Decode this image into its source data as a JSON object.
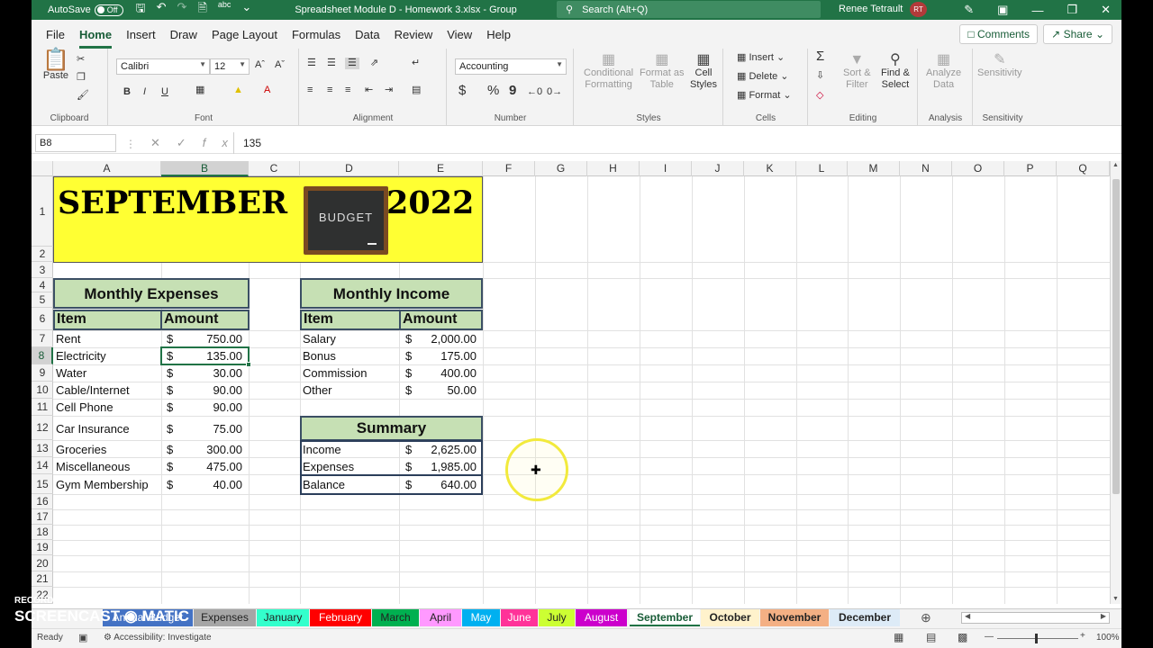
{
  "titlebar": {
    "autosave_label": "AutoSave",
    "autosave_state": "Off",
    "document_title": "Spreadsheet Module D - Homework 3.xlsx  -  Group",
    "search_placeholder": "Search (Alt+Q)",
    "user_name": "Renee Tetrault",
    "user_initials": "RT"
  },
  "menu": {
    "tabs": [
      "File",
      "Home",
      "Insert",
      "Draw",
      "Page Layout",
      "Formulas",
      "Data",
      "Review",
      "View",
      "Help"
    ],
    "active": "Home",
    "comments_label": "Comments",
    "share_label": "Share"
  },
  "ribbon": {
    "clipboard": {
      "paste": "Paste",
      "label": "Clipboard"
    },
    "font": {
      "name": "Calibri",
      "size": "12",
      "label": "Font",
      "bold": "B",
      "italic": "I",
      "underline": "U"
    },
    "alignment": {
      "label": "Alignment"
    },
    "number": {
      "format": "Accounting",
      "label": "Number",
      "currency": "$",
      "percent": "%",
      "comma": "9"
    },
    "styles": {
      "conditional": "Conditional",
      "formatting": "Formatting",
      "format_as": "Format as",
      "table": "Table",
      "cell": "Cell",
      "cell_styles": "Styles",
      "label": "Styles"
    },
    "cells": {
      "insert": "Insert",
      "delete": "Delete",
      "format": "Format",
      "label": "Cells"
    },
    "editing": {
      "sort": "Sort &",
      "filter": "Filter",
      "find": "Find &",
      "select": "Select",
      "label": "Editing"
    },
    "analysis": {
      "analyze": "Analyze",
      "data": "Data",
      "label": "Analysis"
    },
    "sensitivity": {
      "name": "Sensitivity",
      "label": "Sensitivity"
    }
  },
  "formula_bar": {
    "name_box": "B8",
    "value": "135"
  },
  "columns": [
    "A",
    "B",
    "C",
    "D",
    "E",
    "F",
    "G",
    "H",
    "I",
    "J",
    "K",
    "L",
    "M",
    "N",
    "O",
    "P",
    "Q"
  ],
  "rows": [
    "1",
    "2",
    "3",
    "4",
    "5",
    "6",
    "7",
    "8",
    "9",
    "10",
    "11",
    "12",
    "13",
    "14",
    "15",
    "16",
    "17",
    "18",
    "19",
    "20",
    "21",
    "22"
  ],
  "sheet": {
    "title_month": "SEPTEMBER",
    "title_year": "2022",
    "board_text": "BUDGET",
    "expenses_title": "Monthly Expenses",
    "income_title": "Monthly Income",
    "summary_title": "Summary",
    "item_header": "Item",
    "amount_header": "Amount",
    "currency": "$",
    "expenses": [
      {
        "item": "Rent",
        "amount": "750.00"
      },
      {
        "item": "Electricity",
        "amount": "135.00"
      },
      {
        "item": "Water",
        "amount": "30.00"
      },
      {
        "item": "Cable/Internet",
        "amount": "90.00"
      },
      {
        "item": "Cell Phone",
        "amount": "90.00"
      },
      {
        "item": "Car Insurance",
        "amount": "75.00"
      },
      {
        "item": "Groceries",
        "amount": "300.00"
      },
      {
        "item": "Miscellaneous",
        "amount": "475.00"
      },
      {
        "item": "Gym Membership",
        "amount": "40.00"
      }
    ],
    "income": [
      {
        "item": "Salary",
        "amount": "2,000.00"
      },
      {
        "item": "Bonus",
        "amount": "175.00"
      },
      {
        "item": "Commission",
        "amount": "400.00"
      },
      {
        "item": "Other",
        "amount": "50.00"
      }
    ],
    "summary": [
      {
        "item": "Income",
        "amount": "2,625.00"
      },
      {
        "item": "Expenses",
        "amount": "1,985.00"
      },
      {
        "item": "Balance",
        "amount": "640.00"
      }
    ]
  },
  "sheet_tabs": [
    {
      "name": "Annual Budget",
      "color": "#4472c4"
    },
    {
      "name": "Expenses",
      "color": "#a6a6a6"
    },
    {
      "name": "January",
      "color": "#33ffcc"
    },
    {
      "name": "February",
      "color": "#ff0000"
    },
    {
      "name": "March",
      "color": "#00b050"
    },
    {
      "name": "April",
      "color": "#ff99ff"
    },
    {
      "name": "May",
      "color": "#00b0f0"
    },
    {
      "name": "June",
      "color": "#ff3399"
    },
    {
      "name": "July",
      "color": "#ccff33"
    },
    {
      "name": "August",
      "color": "#cc00cc"
    },
    {
      "name": "September",
      "color": "#ffffff"
    },
    {
      "name": "October",
      "color": "#fff2cc"
    },
    {
      "name": "November",
      "color": "#f4b084"
    },
    {
      "name": "December",
      "color": "#ddebf7"
    }
  ],
  "active_sheet": "September",
  "status": {
    "ready": "Ready",
    "accessibility": "Accessibility: Investigate",
    "zoom": "100%"
  },
  "watermark": {
    "line1": "RECORDED WITH",
    "line2": "SCREENCAST",
    "line3": "MATIC"
  }
}
